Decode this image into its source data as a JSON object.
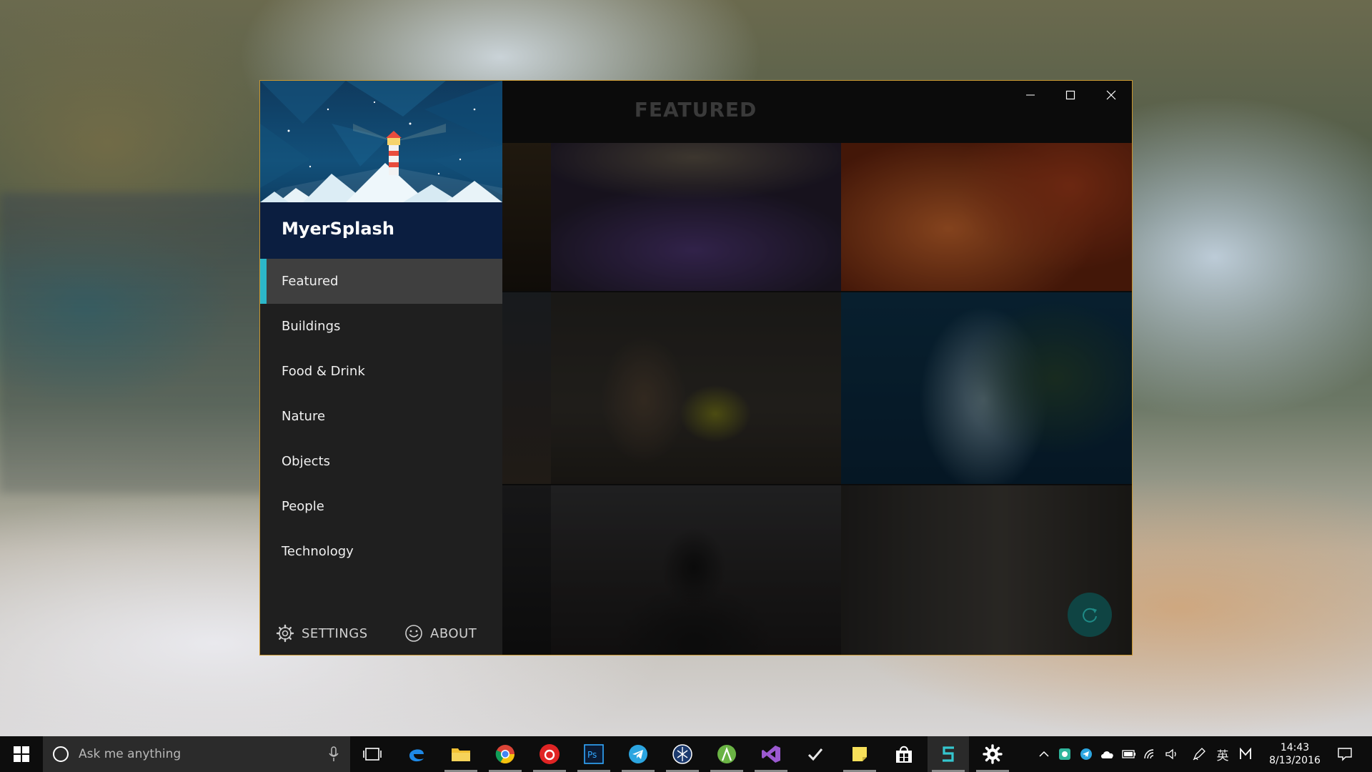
{
  "window": {
    "app_title": "MyerSplash",
    "page_title": "FEATURED",
    "caption_buttons": [
      "minimize",
      "maximize",
      "close"
    ]
  },
  "nav": {
    "items": [
      {
        "label": "Featured",
        "active": true
      },
      {
        "label": "Buildings",
        "active": false
      },
      {
        "label": "Food & Drink",
        "active": false
      },
      {
        "label": "Nature",
        "active": false
      },
      {
        "label": "Objects",
        "active": false
      },
      {
        "label": "People",
        "active": false
      },
      {
        "label": "Technology",
        "active": false
      }
    ],
    "settings_label": "SETTINGS",
    "about_label": "ABOUT",
    "settings_icon": "gear-icon",
    "about_icon": "smiley-icon"
  },
  "gallery": {
    "tiles": [
      "lavender-field",
      "flamingo",
      "cat",
      "coastline-aerial",
      "person-silhouette",
      "alley-walker"
    ]
  },
  "refresh_button_icon": "refresh-icon",
  "colors": {
    "accent": "#2cb7c9",
    "window_border": "#c8962f",
    "nav_background": "#1f1f1f",
    "active_item": "#3f3f3f"
  },
  "taskbar": {
    "search_placeholder": "Ask me anything",
    "apps": [
      "task-view",
      "edge",
      "file-explorer",
      "chrome",
      "netease-music",
      "photoshop",
      "telegram",
      "app-globe",
      "android-studio",
      "visual-studio",
      "wunderlist",
      "sticky-notes",
      "store",
      "myersplash",
      "settings"
    ],
    "ime_label": "英",
    "clock_time": "14:43",
    "clock_date": "8/13/2016"
  }
}
